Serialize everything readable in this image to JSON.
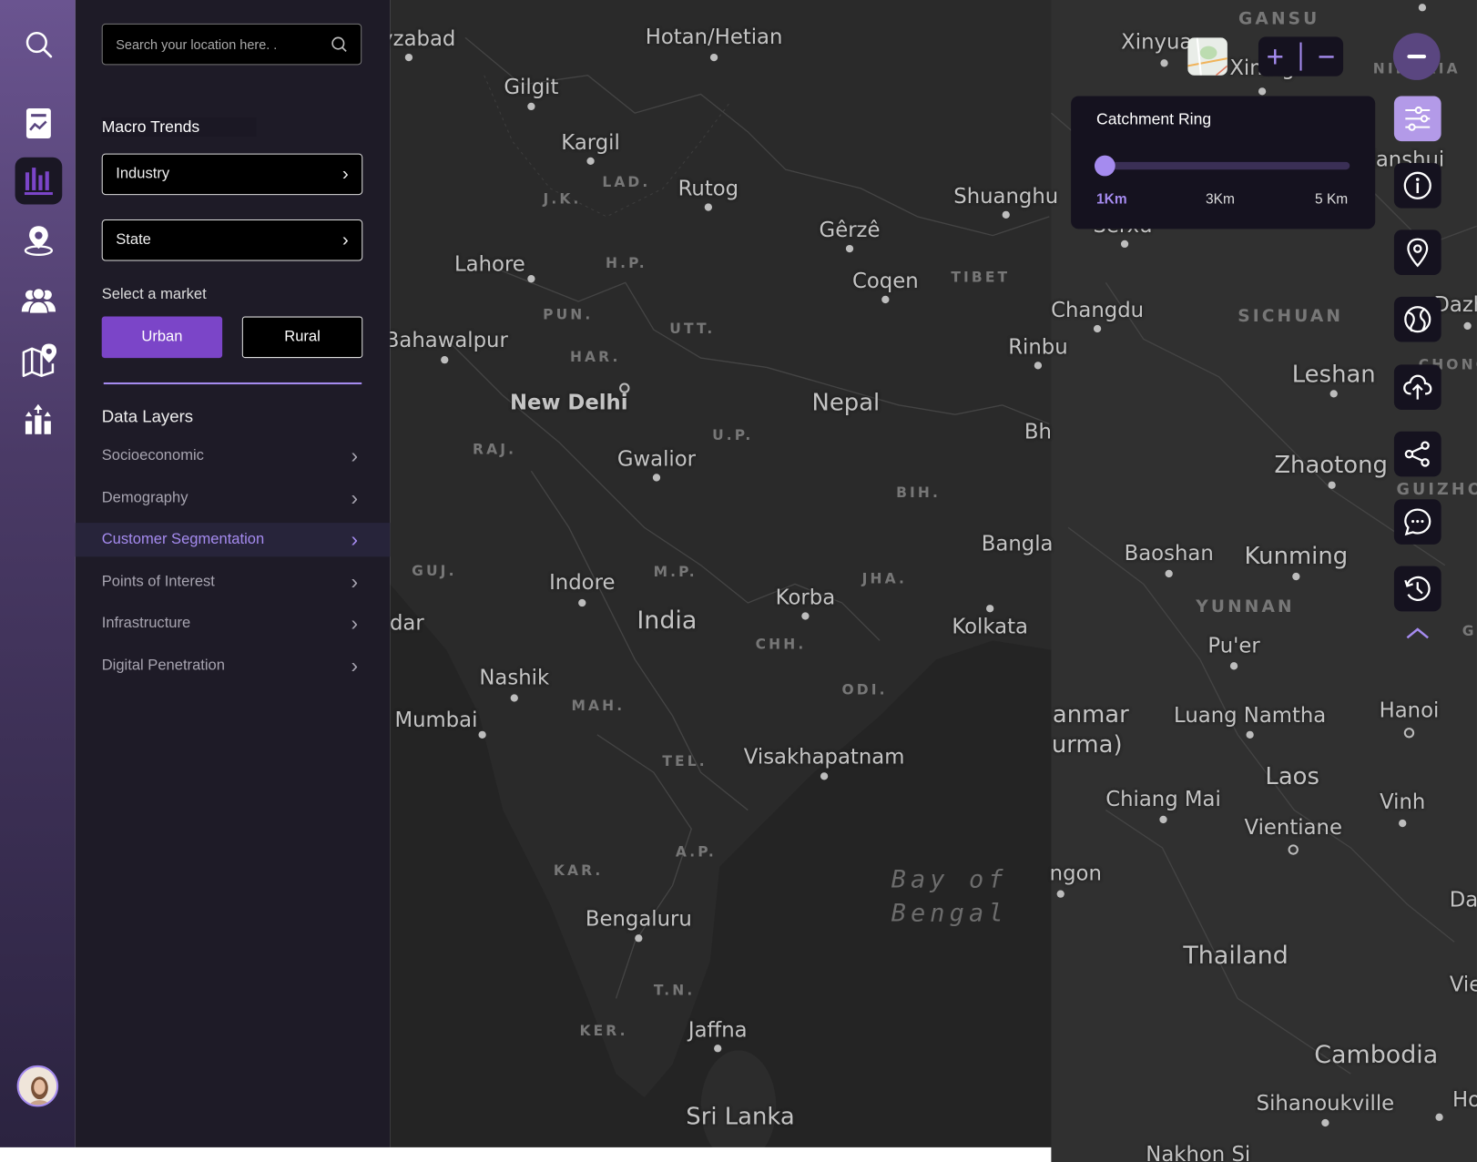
{
  "sidebar": {
    "icons": [
      "search-icon",
      "report-icon",
      "bar-chart-icon",
      "location-icon",
      "users-icon",
      "map-pin-icon",
      "growth-icon"
    ],
    "active": "bar-chart-icon"
  },
  "panel": {
    "search_placeholder": "Search your location here. .",
    "macro_trends": "Macro Trends",
    "industry": "Industry",
    "state": "State",
    "market_label": "Select a market",
    "urban": "Urban",
    "rural": "Rural",
    "data_layers": "Data Layers",
    "layers": [
      {
        "label": "Socioeconomic"
      },
      {
        "label": "Demography"
      },
      {
        "label": "Customer Segmentation",
        "active": true
      },
      {
        "label": "Points of Interest"
      },
      {
        "label": "Infrastructure"
      },
      {
        "label": "Digital Penetration"
      }
    ]
  },
  "colors": {
    "accent": "#7b45c8",
    "accent_light": "#a58bef",
    "panel": "#1e1b27",
    "tool_bg": "#15121f"
  },
  "map": {
    "cities": [
      "Hotan/Hetian",
      "yzabad",
      "Gilgit",
      "Kargil",
      "Rutog",
      "Shuanghu",
      "Gêrzê",
      "Lahore",
      "Coqen",
      "Bahawalpur",
      "New Delhi",
      "Nepal",
      "Rinbu",
      "Gwalior",
      "Bh",
      "Bangla",
      "Indore",
      "Korba",
      "India",
      "Kolkata",
      "dar",
      "Nashik",
      "Mumbai",
      "Visakhapatnam",
      "Bengaluru",
      "Jaffna",
      "Sri Lanka",
      "Xinyua",
      "Xining",
      "Changdu",
      "Leshan",
      "Zhaotong",
      "Baoshan",
      "Kunming",
      "Pu'er",
      "anmar",
      "urma)",
      "Luang Namtha",
      "Hanoi",
      "Laos",
      "Chiang Mai",
      "Vinh",
      "Vientiane",
      "ngon",
      "Thailand",
      "Cambodia",
      "Sihanoukville",
      "Nakhon Si",
      "Ho",
      "Dazh",
      "ianshui",
      "Da",
      "Vie",
      "Serxu"
    ],
    "regions": [
      "LAD.",
      "J.K.",
      "H.P.",
      "TIBET",
      "PUN.",
      "UTT.",
      "HAR.",
      "U.P.",
      "RAJ.",
      "BIH.",
      "GUJ.",
      "M.P.",
      "JHA.",
      "CHH.",
      "MAH.",
      "ODI.",
      "TEL.",
      "A.P.",
      "KAR.",
      "T.N.",
      "KER.",
      "GANSU",
      "NINGXIA",
      "SICHUAN",
      "GUIZHO",
      "YUNNAN",
      "G",
      "CHONG"
    ],
    "sea": [
      "Bay of",
      "Bengal"
    ]
  },
  "zoom": {
    "in": "+",
    "out": "−"
  },
  "catchment": {
    "title": "Catchment Ring",
    "value_km": 1,
    "min_km": 1,
    "max_km": 5,
    "ticks": [
      "1Km",
      "3Km",
      "5 Km"
    ]
  },
  "tools": [
    "collapse-icon",
    "filter-icon",
    "info-icon",
    "location-pin-icon",
    "globe-icon",
    "upload-icon",
    "share-icon",
    "chat-icon",
    "history-icon",
    "chevron-up-icon"
  ]
}
